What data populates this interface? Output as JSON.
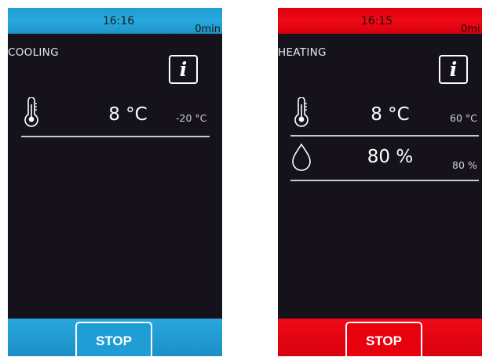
{
  "cooling_panel": {
    "clock": "16:16",
    "timer": "0min",
    "mode_label": "COOLING",
    "info_button_glyph": "i",
    "temperature": {
      "icon": "thermometer-icon",
      "value": "8 °C",
      "setpoint": "-20 °C"
    },
    "stop_label": "STOP",
    "accent_color": "#1f9dd5"
  },
  "heating_panel": {
    "clock": "16:15",
    "timer": "0mi",
    "mode_label": "HEATING",
    "info_button_glyph": "i",
    "temperature": {
      "icon": "thermometer-icon",
      "value": "8 °C",
      "setpoint": "60 °C"
    },
    "humidity": {
      "icon": "water-drop-icon",
      "value": "80 %",
      "setpoint": "80 %"
    },
    "stop_label": "STOP",
    "accent_color": "#e8000f"
  }
}
